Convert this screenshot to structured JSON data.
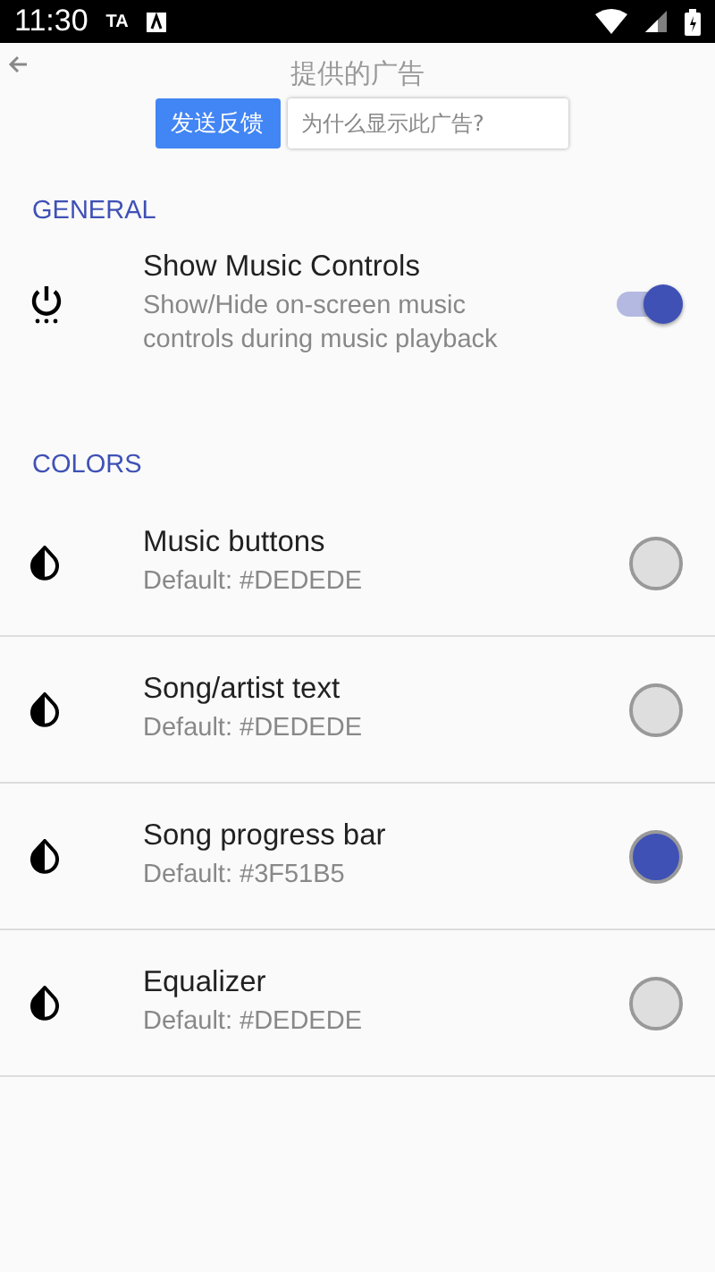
{
  "status_bar": {
    "time": "11:30",
    "notification_text": "TA"
  },
  "ad": {
    "title": "提供的广告",
    "feedback_button": "发送反馈",
    "why_button": "为什么显示此广告?"
  },
  "sections": [
    {
      "kind": "toggles",
      "header": "GENERAL",
      "items": [
        {
          "title": "Show Music Controls",
          "summary": "Show/Hide on-screen music controls during music playback",
          "on": true
        }
      ]
    },
    {
      "kind": "colors",
      "header": "COLORS",
      "items": [
        {
          "title": "Music buttons",
          "summary": "Default: #DEDEDE",
          "color": "#dedede"
        },
        {
          "title": "Song/artist text",
          "summary": "Default: #DEDEDE",
          "color": "#dedede"
        },
        {
          "title": "Song progress bar",
          "summary": "Default: #3F51B5",
          "color": "#3f51b5"
        },
        {
          "title": "Equalizer",
          "summary": "Default: #DEDEDE",
          "color": "#dedede"
        }
      ]
    }
  ]
}
